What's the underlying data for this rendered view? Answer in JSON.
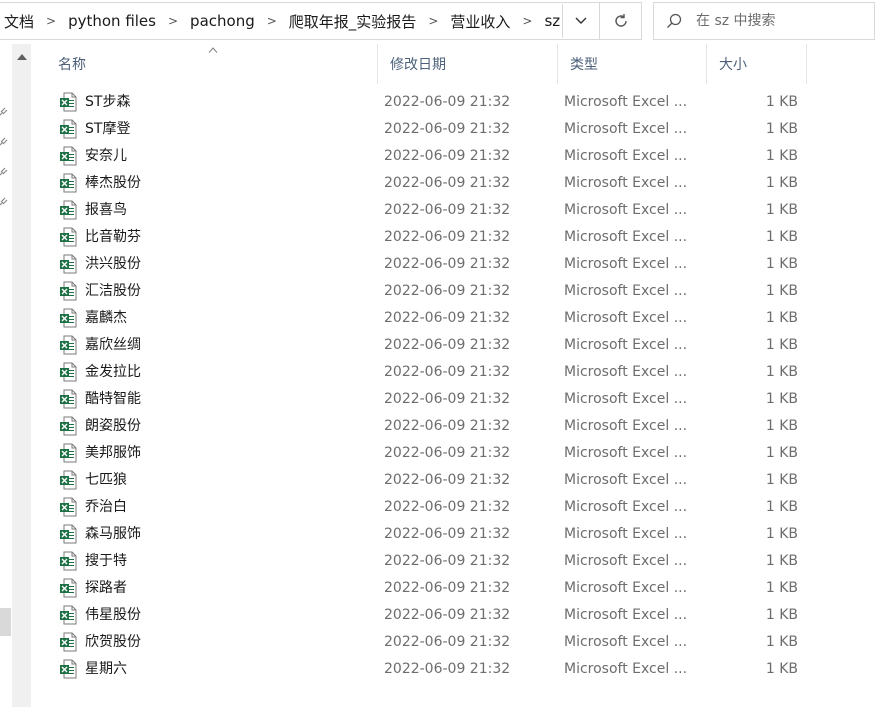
{
  "address": {
    "crumbs": [
      "文档",
      "python files",
      "pachong",
      "爬取年报_实验报告",
      "营业收入",
      "sz"
    ],
    "separator": ">",
    "dropdown_glyph": "⌄",
    "refresh_icon": "refresh-icon"
  },
  "search": {
    "placeholder": "在 sz 中搜索",
    "icon": "search-icon"
  },
  "columns": {
    "name": "名称",
    "date": "修改日期",
    "type": "类型",
    "size": "大小"
  },
  "files": [
    {
      "name": "ST步森",
      "date": "2022-06-09 21:32",
      "type": "Microsoft Excel ...",
      "size": "1 KB"
    },
    {
      "name": "ST摩登",
      "date": "2022-06-09 21:32",
      "type": "Microsoft Excel ...",
      "size": "1 KB"
    },
    {
      "name": "安奈儿",
      "date": "2022-06-09 21:32",
      "type": "Microsoft Excel ...",
      "size": "1 KB"
    },
    {
      "name": "棒杰股份",
      "date": "2022-06-09 21:32",
      "type": "Microsoft Excel ...",
      "size": "1 KB"
    },
    {
      "name": "报喜鸟",
      "date": "2022-06-09 21:32",
      "type": "Microsoft Excel ...",
      "size": "1 KB"
    },
    {
      "name": "比音勒芬",
      "date": "2022-06-09 21:32",
      "type": "Microsoft Excel ...",
      "size": "1 KB"
    },
    {
      "name": "洪兴股份",
      "date": "2022-06-09 21:32",
      "type": "Microsoft Excel ...",
      "size": "1 KB"
    },
    {
      "name": "汇洁股份",
      "date": "2022-06-09 21:32",
      "type": "Microsoft Excel ...",
      "size": "1 KB"
    },
    {
      "name": "嘉麟杰",
      "date": "2022-06-09 21:32",
      "type": "Microsoft Excel ...",
      "size": "1 KB"
    },
    {
      "name": "嘉欣丝绸",
      "date": "2022-06-09 21:32",
      "type": "Microsoft Excel ...",
      "size": "1 KB"
    },
    {
      "name": "金发拉比",
      "date": "2022-06-09 21:32",
      "type": "Microsoft Excel ...",
      "size": "1 KB"
    },
    {
      "name": "酷特智能",
      "date": "2022-06-09 21:32",
      "type": "Microsoft Excel ...",
      "size": "1 KB"
    },
    {
      "name": "朗姿股份",
      "date": "2022-06-09 21:32",
      "type": "Microsoft Excel ...",
      "size": "1 KB"
    },
    {
      "name": "美邦服饰",
      "date": "2022-06-09 21:32",
      "type": "Microsoft Excel ...",
      "size": "1 KB"
    },
    {
      "name": "七匹狼",
      "date": "2022-06-09 21:32",
      "type": "Microsoft Excel ...",
      "size": "1 KB"
    },
    {
      "name": "乔治白",
      "date": "2022-06-09 21:32",
      "type": "Microsoft Excel ...",
      "size": "1 KB"
    },
    {
      "name": "森马服饰",
      "date": "2022-06-09 21:32",
      "type": "Microsoft Excel ...",
      "size": "1 KB"
    },
    {
      "name": "搜于特",
      "date": "2022-06-09 21:32",
      "type": "Microsoft Excel ...",
      "size": "1 KB"
    },
    {
      "name": "探路者",
      "date": "2022-06-09 21:32",
      "type": "Microsoft Excel ...",
      "size": "1 KB"
    },
    {
      "name": "伟星股份",
      "date": "2022-06-09 21:32",
      "type": "Microsoft Excel ...",
      "size": "1 KB"
    },
    {
      "name": "欣贺股份",
      "date": "2022-06-09 21:32",
      "type": "Microsoft Excel ...",
      "size": "1 KB"
    },
    {
      "name": "星期六",
      "date": "2022-06-09 21:32",
      "type": "Microsoft Excel ...",
      "size": "1 KB"
    }
  ],
  "file_icon": "excel-file-icon",
  "colors": {
    "header_text": "#4c607a",
    "excel_green": "#1e7145",
    "secondary_text": "#6d6d6d"
  }
}
